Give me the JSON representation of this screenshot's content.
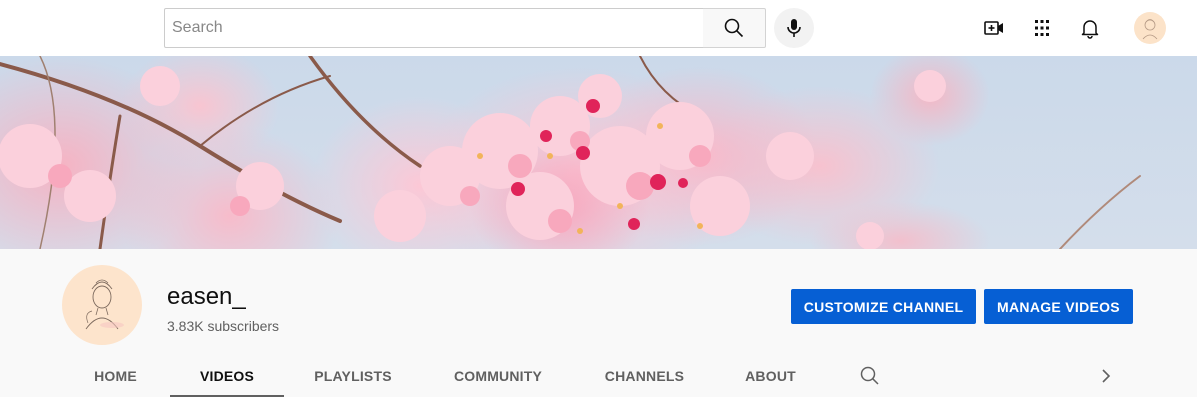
{
  "search": {
    "placeholder": "Search"
  },
  "icons": {
    "search": "search-icon",
    "mic": "microphone-icon",
    "create": "video-add-icon",
    "apps": "apps-grid-icon",
    "notifications": "bell-icon",
    "avatar": "avatar"
  },
  "channel": {
    "name": "easen_",
    "subscribers": "3.83K subscribers"
  },
  "actions": {
    "customize": "CUSTOMIZE CHANNEL",
    "manage": "MANAGE VIDEOS"
  },
  "tabs": [
    {
      "label": "HOME",
      "active": false
    },
    {
      "label": "VIDEOS",
      "active": true
    },
    {
      "label": "PLAYLISTS",
      "active": false
    },
    {
      "label": "COMMUNITY",
      "active": false
    },
    {
      "label": "CHANNELS",
      "active": false
    },
    {
      "label": "ABOUT",
      "active": false
    }
  ],
  "colors": {
    "accent": "#065fd4",
    "text_primary": "#0f0f0f",
    "text_secondary": "#606060"
  }
}
